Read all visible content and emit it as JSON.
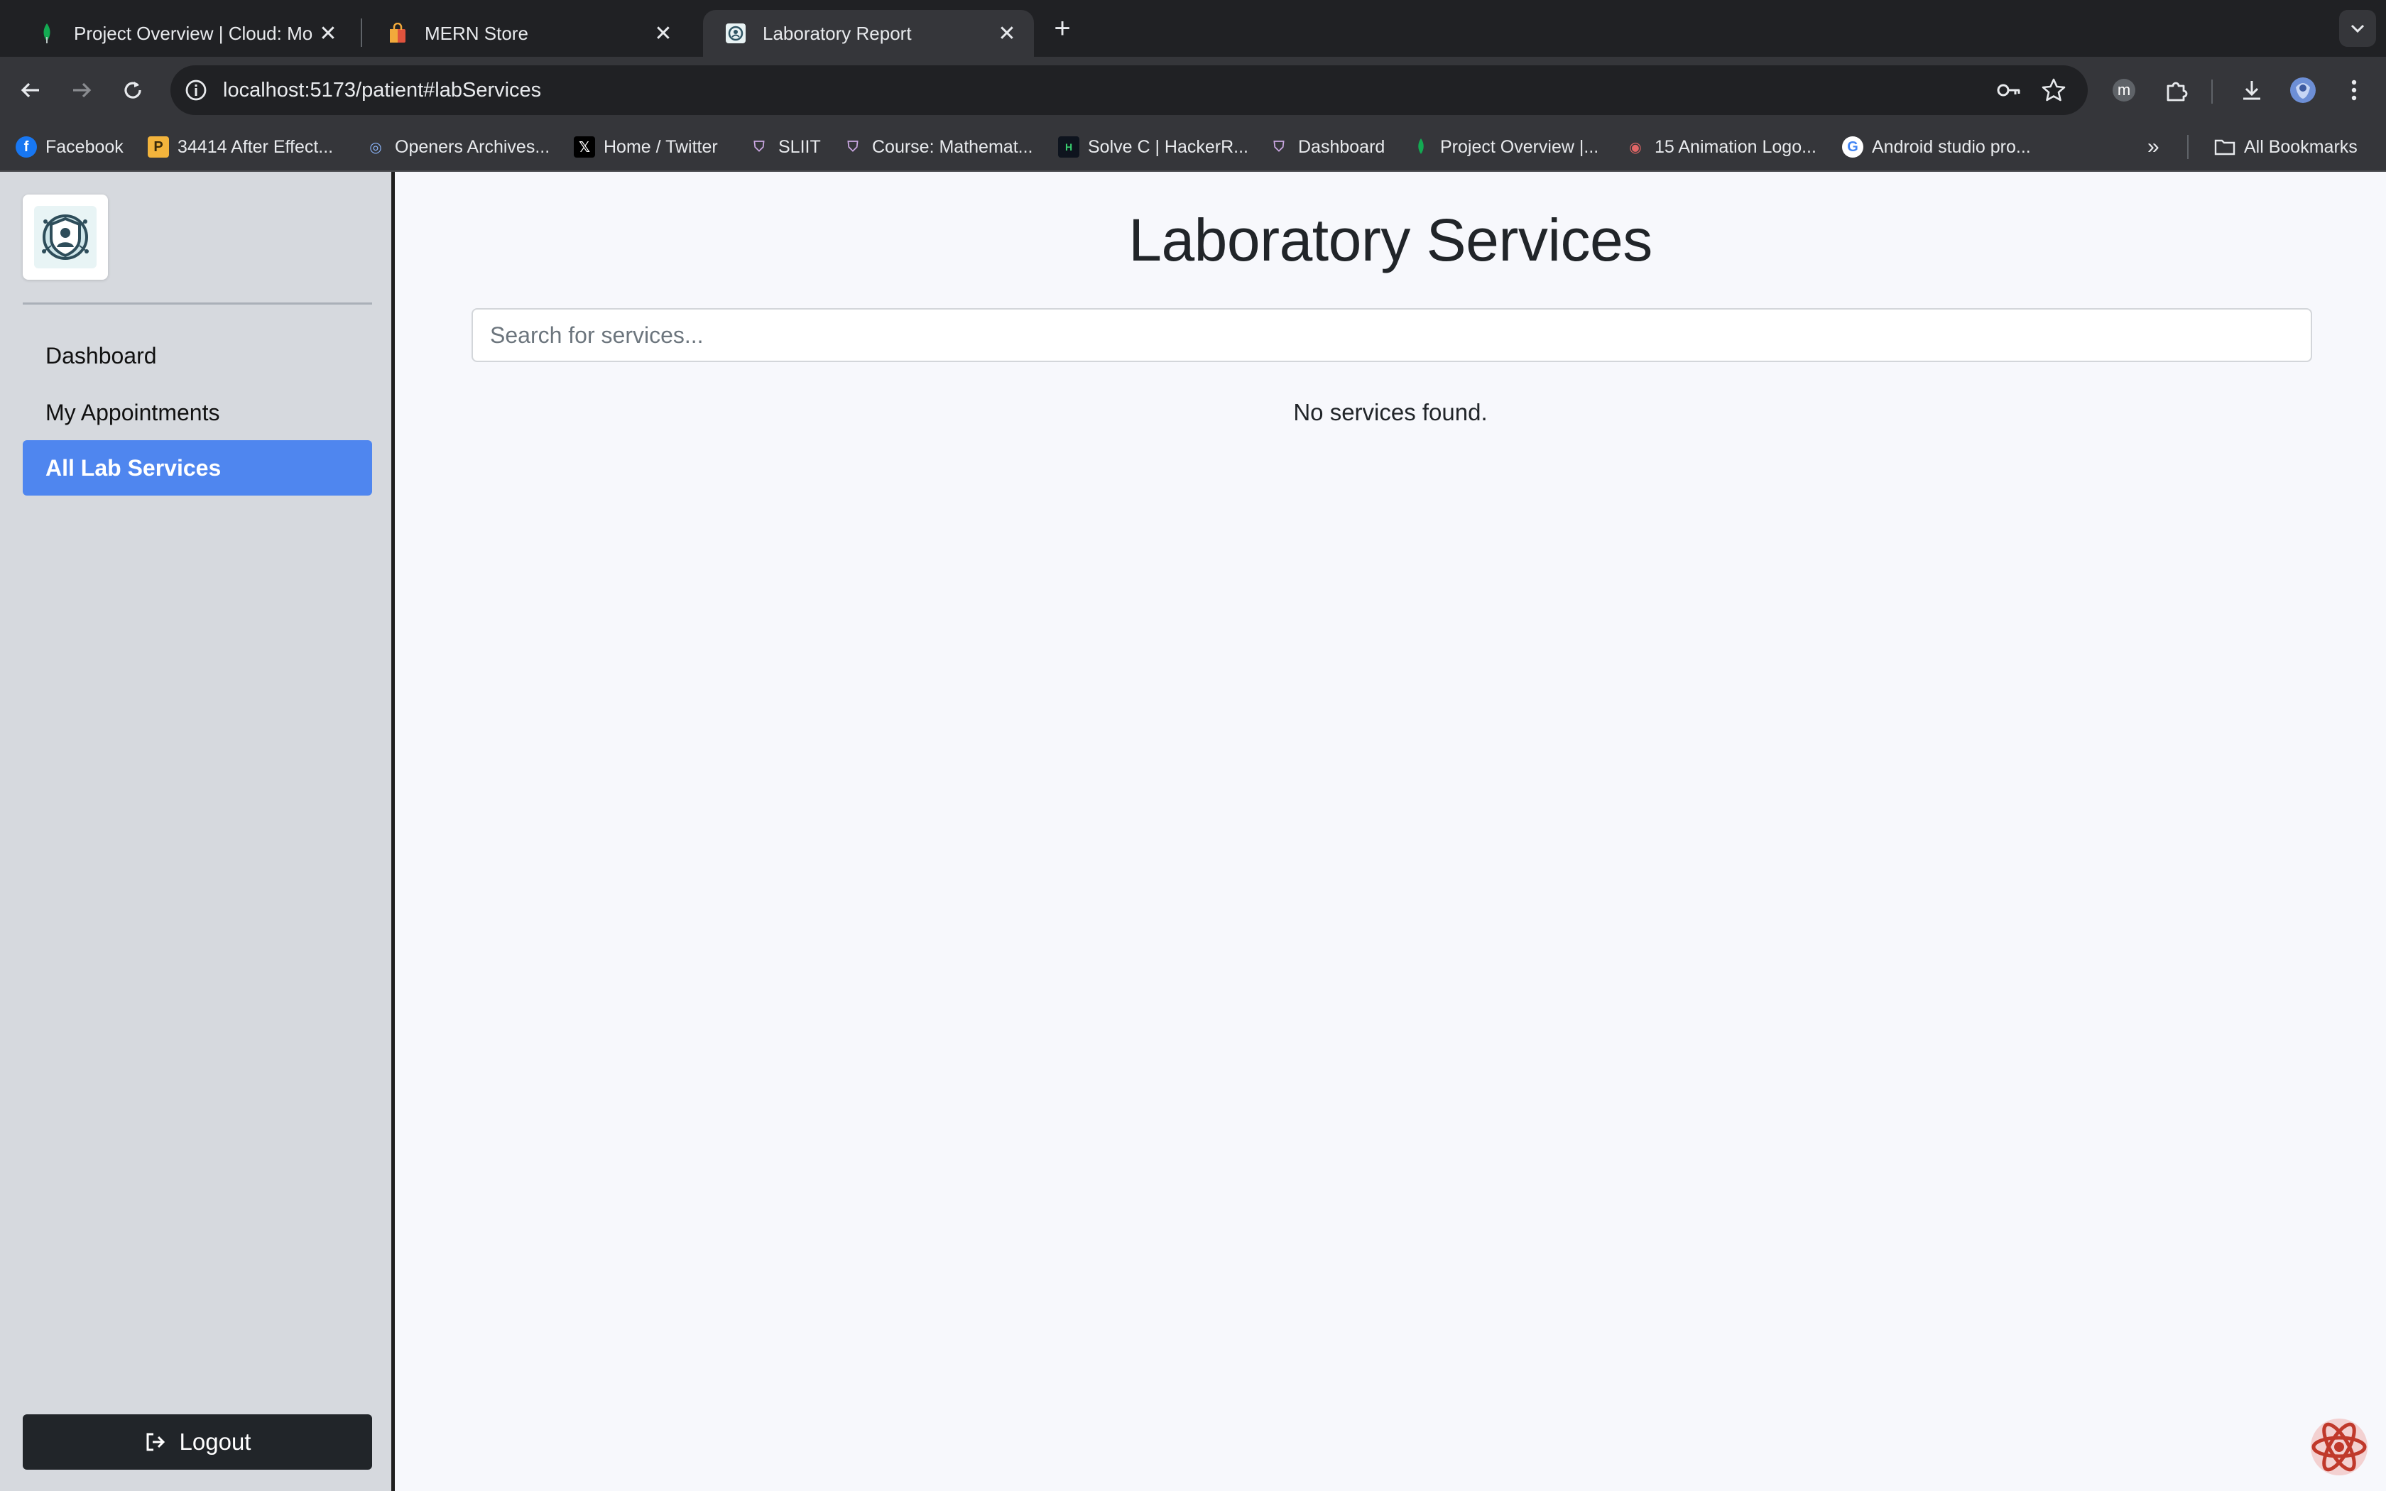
{
  "browser": {
    "tabs": [
      {
        "title": "Project Overview | Cloud: Mo",
        "active": false,
        "favicon": "mongodb-leaf-icon"
      },
      {
        "title": "MERN Store",
        "active": false,
        "favicon": "store-bag-icon"
      },
      {
        "title": "Laboratory Report",
        "active": true,
        "favicon": "lab-logo-icon"
      }
    ],
    "url": "localhost:5173/patient#labServices",
    "bookmarks": [
      {
        "label": "Facebook",
        "icon": "facebook-icon"
      },
      {
        "label": "34414 After Effect...",
        "icon": "p-icon"
      },
      {
        "label": "Openers Archives...",
        "icon": "openers-icon"
      },
      {
        "label": "Home / Twitter",
        "icon": "x-twitter-icon"
      },
      {
        "label": "SLIIT",
        "icon": "sliit-icon"
      },
      {
        "label": "Course: Mathemat...",
        "icon": "sliit-icon"
      },
      {
        "label": "Solve C | HackerR...",
        "icon": "hackerrank-icon"
      },
      {
        "label": "Dashboard",
        "icon": "sliit-icon"
      },
      {
        "label": "Project Overview |...",
        "icon": "mongodb-leaf-icon"
      },
      {
        "label": "15 Animation Logo...",
        "icon": "animation-icon"
      },
      {
        "label": "Android studio pro...",
        "icon": "google-icon"
      }
    ],
    "all_bookmarks_label": "All Bookmarks",
    "profile_letter": "m"
  },
  "sidebar": {
    "items": [
      {
        "label": "Dashboard",
        "active": false
      },
      {
        "label": "My Appointments",
        "active": false
      },
      {
        "label": "All Lab Services",
        "active": true
      }
    ],
    "logout_label": "Logout"
  },
  "main": {
    "title": "Laboratory Services",
    "search_placeholder": "Search for services...",
    "search_value": "",
    "empty_message": "No services found."
  },
  "colors": {
    "accent": "#4f86ef",
    "sidebar_bg": "#d6d9de",
    "logout_bg": "#212529",
    "page_bg": "#f7f8fc"
  }
}
